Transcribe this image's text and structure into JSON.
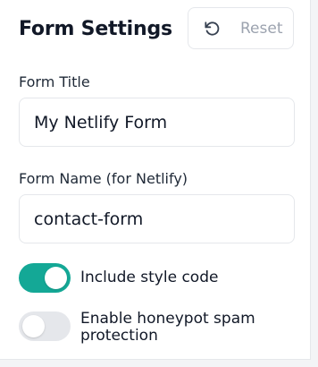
{
  "header": {
    "title": "Form Settings",
    "reset_label": "Reset",
    "reset_icon": "rotate-ccw-icon"
  },
  "fields": {
    "form_title": {
      "label": "Form Title",
      "value": "My Netlify Form"
    },
    "form_name": {
      "label": "Form Name (for Netlify)",
      "value": "contact-form"
    }
  },
  "toggles": {
    "style_code": {
      "label": "Include style code",
      "enabled": true
    },
    "honeypot": {
      "label": "Enable honeypot spam protection",
      "enabled": false
    }
  },
  "colors": {
    "toggle_on": "#14a896",
    "toggle_off": "#e5e7eb"
  }
}
